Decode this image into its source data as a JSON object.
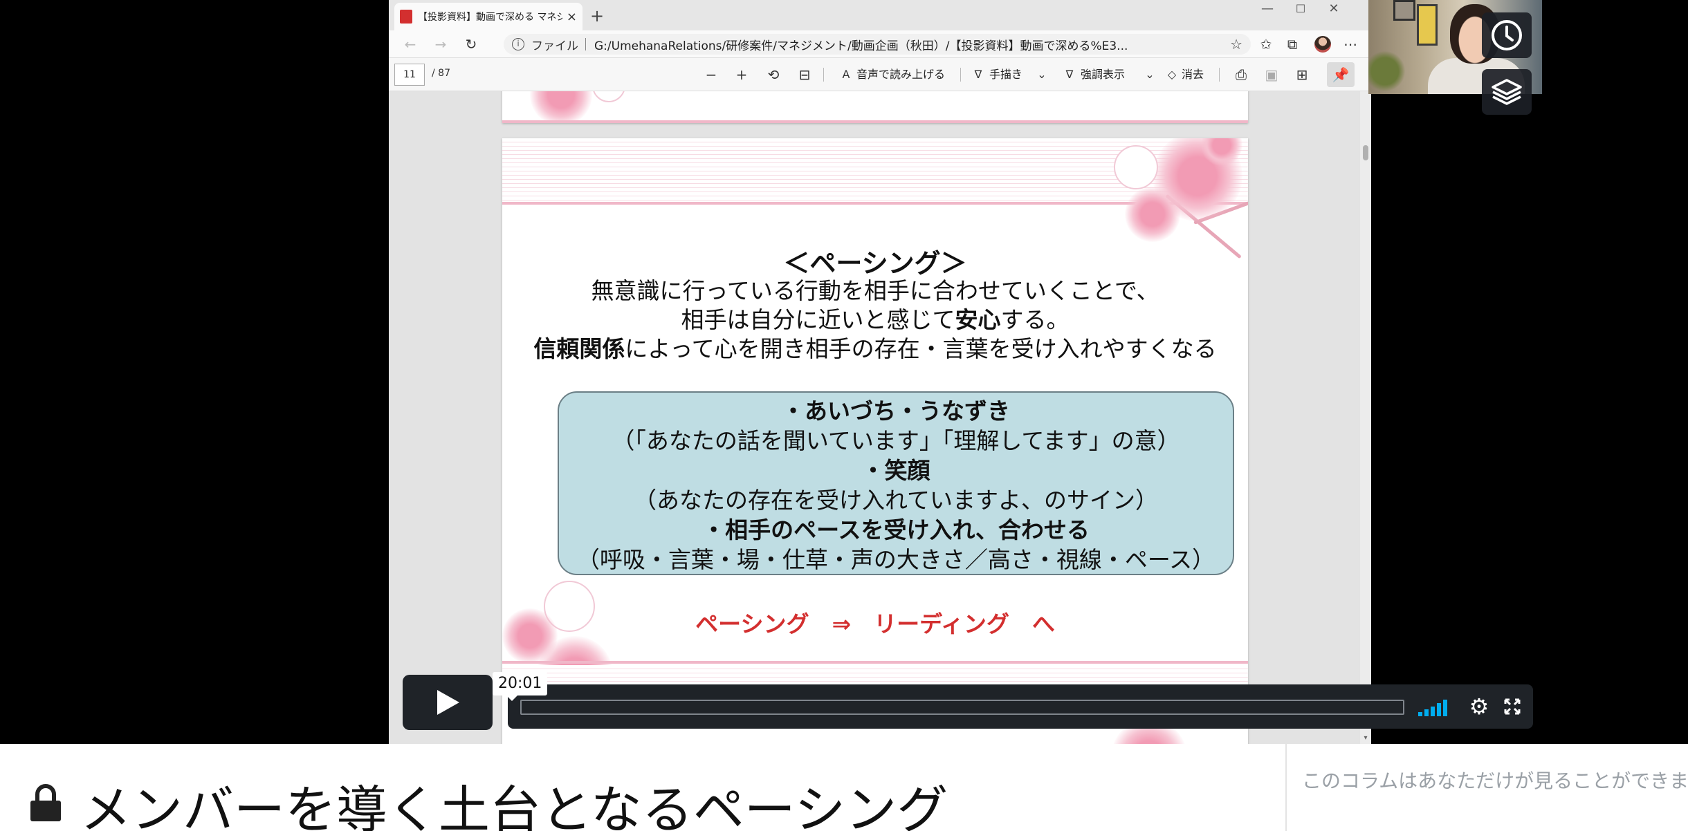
{
  "browser": {
    "tab_title": "【投影資料】動画で深める マネジメ",
    "tab_close": "×",
    "new_tab": "+",
    "window_controls": [
      "—",
      "☐",
      "✕"
    ],
    "scheme_label": "ファイル",
    "url": "G:/UmehanaRelations/研修案件/マネジメント/動画企画（秋田）/【投影資料】動画で深める%E3...",
    "icons": [
      "back-icon",
      "forward-icon",
      "refresh-icon",
      "info-icon",
      "star-icon",
      "favorites-icon",
      "collections-icon",
      "profile-icon",
      "more-icon"
    ]
  },
  "pdf_toolbar": {
    "page_current": "11",
    "page_total": "/ 87",
    "read_aloud": "音声で読み上げる",
    "draw": "手描き",
    "highlight": "強調表示",
    "erase": "消去"
  },
  "slide": {
    "heading": "＜ペーシング＞",
    "line1": "無意識に行っている行動を相手に合わせていくことで、",
    "line2_pre": "相手は自分に近いと感じて",
    "line2_bold": "安心",
    "line2_post": "する。",
    "line3_bold": "信頼関係",
    "line3_post": "によって心を開き相手の存在・言葉を受け入れやすくなる",
    "box": [
      {
        "text": "・あいづち・うなずき",
        "bold": true
      },
      {
        "text": "（「あなたの話を聞いています」「理解してます」の意）",
        "bold": false
      },
      {
        "text": "・笑顔",
        "bold": true
      },
      {
        "text": "（あなたの存在を受け入れていますよ、のサイン）",
        "bold": false
      },
      {
        "text": "・相手のペースを受け入れ、合わせる",
        "bold": true
      },
      {
        "text": "（呼吸・言葉・場・仕草・声の大きさ／高さ・視線・ペース）",
        "bold": false
      }
    ],
    "leading": "ペーシング　⇒　リーディング　へ"
  },
  "player": {
    "time_tooltip": "20:01",
    "progress": 0.0,
    "accent_color": "#00adef"
  },
  "page": {
    "course_title": "メンバーを導く土台となるペーシング",
    "side_note": "このコラムはあなただけが見ることができます"
  }
}
